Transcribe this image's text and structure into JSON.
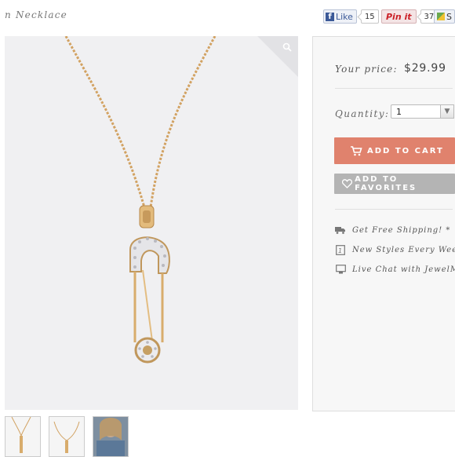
{
  "page": {
    "title_fragment": "n Necklace"
  },
  "social": {
    "facebook": {
      "label": "Like",
      "count": "15"
    },
    "pinterest": {
      "label": "Pin it",
      "count": "37"
    },
    "share": {
      "label": "S"
    }
  },
  "product": {
    "price_label": "Your price:",
    "price": "$29.99",
    "quantity_label": "Quantity:",
    "quantity_value": "1",
    "add_to_cart": "ADD TO CART",
    "add_to_favorites": "ADD TO FAVORITES"
  },
  "features": [
    {
      "icon": "truck-icon",
      "label": "Get Free Shipping! *"
    },
    {
      "icon": "calendar-icon",
      "label": "New Styles Every Week"
    },
    {
      "icon": "monitor-icon",
      "label": "Live Chat with JewelMint"
    }
  ],
  "colors": {
    "cart_button": "#e0826d",
    "favorites_button": "#b4b4b4",
    "gold": "#d9a968"
  }
}
